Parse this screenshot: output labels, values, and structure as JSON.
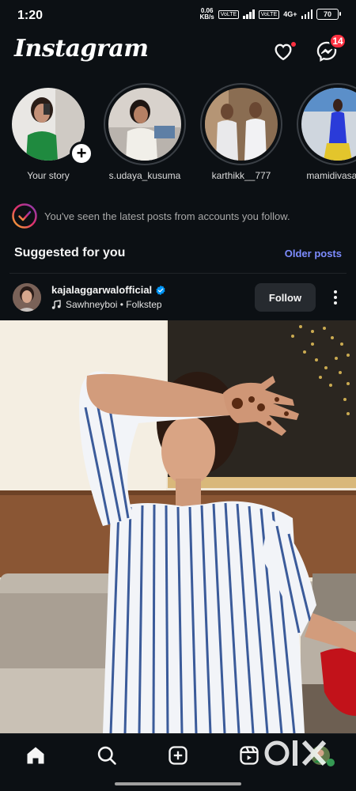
{
  "status_bar": {
    "time": "1:20",
    "net_speed_value": "0.06",
    "net_speed_unit": "KB/s",
    "sim1_tag": "VoLTE",
    "sim2_tag": "VoLTE",
    "network": "4G+",
    "battery": "70"
  },
  "header": {
    "logo": "Instagram",
    "notifications_dot": true,
    "messages_badge": "14"
  },
  "stories": [
    {
      "label": "Your story",
      "own": true
    },
    {
      "label": "s.udaya_kusuma",
      "own": false
    },
    {
      "label": "karthikk__777",
      "own": false
    },
    {
      "label": "mamidivasavi_",
      "own": false
    }
  ],
  "feed": {
    "caught_up_text": "You've seen the latest posts from accounts you follow.",
    "suggested_title": "Suggested for you",
    "older_posts_label": "Older posts"
  },
  "post": {
    "username": "kajalaggarwalofficial",
    "verified": true,
    "music": "Sawhneyboi • Folkstep",
    "follow_label": "Follow"
  },
  "bottom_nav": {
    "items": [
      "home-icon",
      "search-icon",
      "create-icon",
      "reels-icon",
      "profile-icon"
    ],
    "active": "home-icon"
  },
  "watermark": "OLX",
  "colors": {
    "background": "#0c1014",
    "accent_blue": "#7d8cff",
    "badge_red": "#ff3040",
    "button_gray": "#262a2f",
    "verified_blue": "#0095f6"
  }
}
